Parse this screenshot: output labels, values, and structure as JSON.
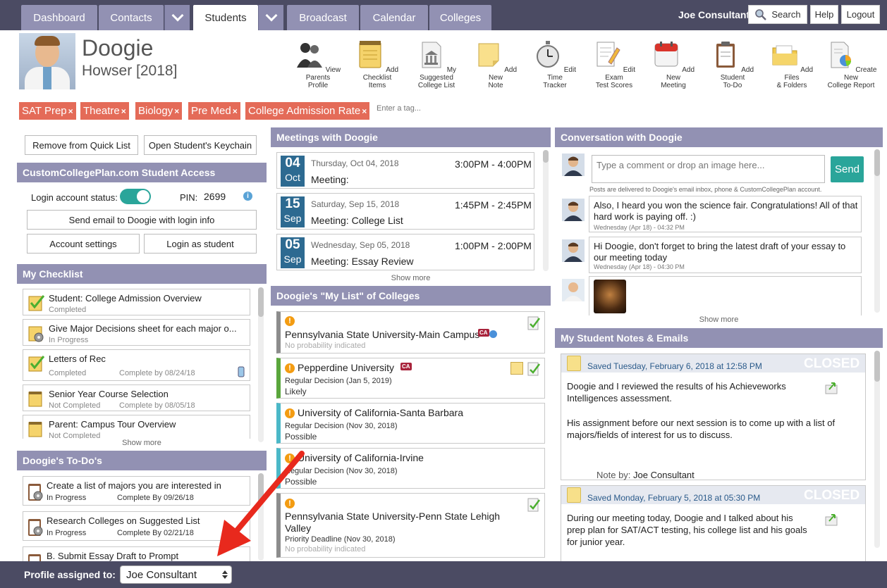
{
  "nav": {
    "tabs": [
      "Dashboard",
      "Contacts",
      "Students",
      "Broadcast",
      "Calendar",
      "Colleges"
    ],
    "user": "Joe Consultant",
    "search": "Search",
    "help": "Help",
    "logout": "Logout"
  },
  "student": {
    "first_name": "Doogie",
    "last_name_year": "Howser [2018]"
  },
  "toolbar": [
    "View Parents\nProfile",
    "Add Checklist\nItems",
    "My Suggested\nCollege List",
    "Add New\nNote",
    "Edit Time\nTracker",
    "Edit Exam\nTest Scores",
    "Add New\nMeeting",
    "Add Student\nTo-Do",
    "Add Files\n& Folders",
    "Create New\nCollege Report"
  ],
  "tags": {
    "items": [
      "SAT Prep",
      "Theatre",
      "Biology",
      "Pre Med",
      "College Admission Rate"
    ],
    "remove": "×",
    "placeholder": "Enter a tag..."
  },
  "left": {
    "remove_quick_list": "Remove from Quick List",
    "open_keychain": "Open Student's Keychain",
    "access_title": "CustomCollegePlan.com Student Access",
    "login_status_label": "Login account status:",
    "pin_label": "PIN:",
    "pin": "2699",
    "send_email": "Send email to Doogie with login info",
    "account_settings": "Account settings",
    "login_as_student": "Login as student",
    "checklist_title": "My Checklist",
    "checklist": [
      {
        "title": "Student: College Admission Overview",
        "status": "Completed",
        "due": ""
      },
      {
        "title": "Give Major Decisions sheet for each major o...",
        "status": "In Progress",
        "due": ""
      },
      {
        "title": "Letters of Rec",
        "status": "Completed",
        "due": "Complete by 08/24/18"
      },
      {
        "title": "Senior Year Course Selection",
        "status": "Not Completed",
        "due": "Complete by 08/05/18"
      },
      {
        "title": "Parent: Campus Tour Overview",
        "status": "Not Completed",
        "due": ""
      }
    ],
    "show_more": "Show more",
    "todo_title": "Doogie's To-Do's",
    "todos": [
      {
        "title": "Create a list of majors you are interested in",
        "status": "In Progress",
        "due": "Complete By 09/26/18"
      },
      {
        "title": "Research Colleges on Suggested List",
        "status": "In Progress",
        "due": "Complete By 02/21/18"
      },
      {
        "title": "B. Submit Essay Draft to Prompt",
        "status": "",
        "due": ""
      }
    ]
  },
  "meetings": {
    "title": "Meetings with Doogie",
    "items": [
      {
        "day": "04",
        "mon": "Oct",
        "date": "Thursday, Oct 04, 2018",
        "time": "3:00PM - 4:00PM",
        "label": "Meeting:"
      },
      {
        "day": "15",
        "mon": "Sep",
        "date": "Saturday, Sep 15, 2018",
        "time": "1:45PM - 2:45PM",
        "label": "Meeting: College List"
      },
      {
        "day": "05",
        "mon": "Sep",
        "date": "Wednesday, Sep 05, 2018",
        "time": "1:00PM - 2:00PM",
        "label": "Meeting: Essay Review"
      }
    ],
    "show_more": "Show more"
  },
  "colleges": {
    "title": "Doogie's \"My List\" of Colleges",
    "items": [
      {
        "name": "Pennsylvania State University-Main Campus",
        "decision": "",
        "status": "No probability indicated",
        "bar": "#8c8c8c"
      },
      {
        "name": "Pepperdine University",
        "decision": "Regular Decision (Jan 5, 2019)",
        "status": "Likely",
        "bar": "#5aa63c"
      },
      {
        "name": "University of California-Santa Barbara",
        "decision": "Regular Decision (Nov 30, 2018)",
        "status": "Possible",
        "bar": "#4bb8c8"
      },
      {
        "name": "University of California-Irvine",
        "decision": "Regular Decision (Nov 30, 2018)",
        "status": "Possible",
        "bar": "#4bb8c8"
      },
      {
        "name": "Pennsylvania State University-Penn State Lehigh Valley",
        "decision": "Priority Deadline (Nov 30, 2018)",
        "status": "No probability indicated",
        "bar": "#8c8c8c"
      }
    ],
    "ca_badge": "CA"
  },
  "conversation": {
    "title": "Conversation with Doogie",
    "placeholder": "Type a comment or drop an image here...",
    "send": "Send",
    "note": "Posts are delivered to Doogie's email inbox, phone & CustomCollegePlan account.",
    "messages": [
      {
        "text": "Also, I heard you won the science fair. Congratulations! All of that hard work is paying off. :)",
        "time": "Wednesday (Apr 18) - 04:32 PM"
      },
      {
        "text": "Hi Doogie, don't forget to bring the latest draft of your essay to our meeting today",
        "time": "Wednesday (Apr 18) - 04:30 PM"
      }
    ],
    "show_more": "Show more"
  },
  "notes": {
    "title": "My Student Notes & Emails",
    "items": [
      {
        "saved": "Saved Tuesday, February 6, 2018 at 12:58 PM",
        "badge": "CLOSED",
        "body1": "Doogie and I reviewed the results of his Achieveworks Intelligences assessment.",
        "body2": "His assignment before our next session is to come up with a list of majors/fields of interest for us to discuss.",
        "note_by": "Note by:",
        "author": "Joe Consultant"
      },
      {
        "saved": "Saved Monday, February 5, 2018 at 05:30 PM",
        "badge": "CLOSED",
        "body1": "During our meeting today, Doogie and I talked about his prep plan for SAT/ACT testing, his college list and his goals for junior year.",
        "body2": "",
        "note_by": "",
        "author": ""
      }
    ]
  },
  "footer": {
    "label": "Profile assigned to:",
    "value": "Joe Consultant"
  },
  "colors": {
    "nav": "#4b4b63",
    "tab": "#9291b3",
    "tag": "#e46b58",
    "accent": "#2aa59a",
    "date_box": "#2d6a91",
    "arrow": "#e8291d"
  }
}
